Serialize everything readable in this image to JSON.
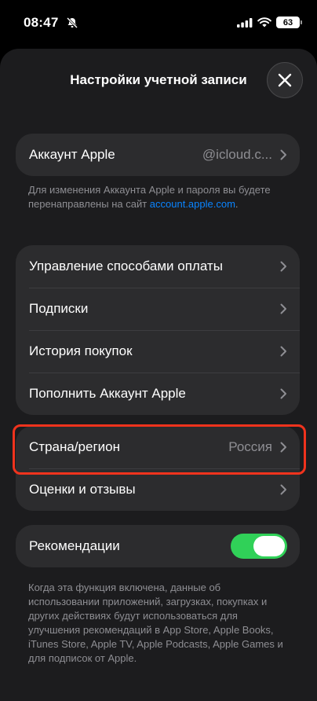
{
  "status": {
    "time": "08:47",
    "battery": "63"
  },
  "sheet": {
    "title": "Настройки учетной записи"
  },
  "account_group": {
    "label": "Аккаунт Apple",
    "value": "@icloud.c..."
  },
  "account_note": {
    "text": "Для изменения Аккаунта Apple и пароля вы будете перенаправлены на сайт ",
    "link": "account.apple.com",
    "suffix": "."
  },
  "main_group": {
    "items": [
      {
        "label": "Управление способами оплаты"
      },
      {
        "label": "Подписки"
      },
      {
        "label": "История покупок"
      },
      {
        "label": "Пополнить Аккаунт Apple"
      }
    ]
  },
  "region_group": {
    "country_label": "Страна/регион",
    "country_value": "Россия",
    "ratings_label": "Оценки и отзывы"
  },
  "recommendations": {
    "label": "Рекомендации",
    "enabled": true,
    "note": "Когда эта функция включена, данные об использовании приложений, загрузках, покупках и других действиях будут использоваться для улучшения рекомендаций в App Store, Apple Books, iTunes Store, Apple TV, Apple Podcasts, Apple Games и для подписок от Apple."
  },
  "colors": {
    "accent_link": "#0a84ff",
    "toggle_on": "#30d158",
    "highlight": "#f0331d"
  }
}
